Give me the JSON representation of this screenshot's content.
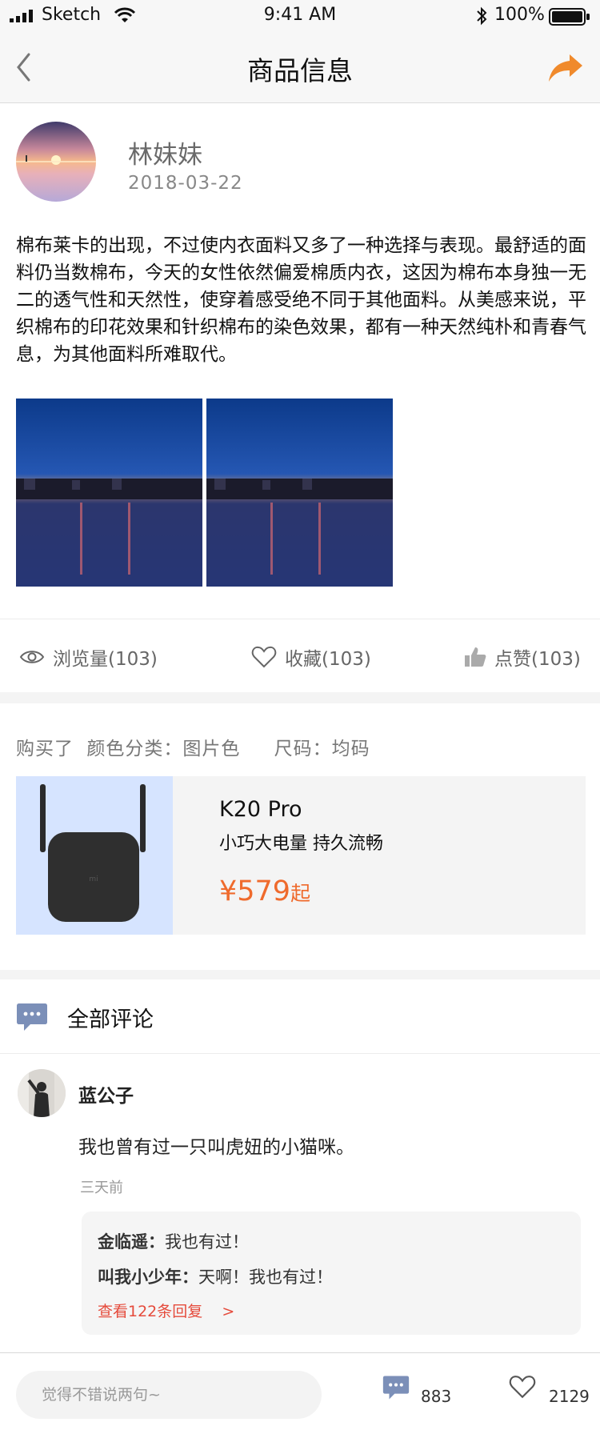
{
  "status_bar": {
    "carrier": "Sketch",
    "time": "9:41 AM",
    "battery": "100%"
  },
  "nav": {
    "title": "商品信息"
  },
  "author": {
    "name": "林妹妹",
    "date": "2018-03-22"
  },
  "post": {
    "text": "棉布莱卡的出现，不过使内衣面料又多了一种选择与表现。最舒适的面料仍当数棉布，今天的女性依然偏爱棉质内衣，这因为棉布本身独一无二的透气性和天然性，使穿着感受绝不同于其他面料。从美感来说，平织棉布的印花效果和针织棉布的染色效果，都有一种天然纯朴和青春气息，为其他面料所难取代。"
  },
  "stats": {
    "views": "浏览量(103)",
    "favorites": "收藏(103)",
    "likes": "点赞(103)"
  },
  "purchase": {
    "prefix": "购买了",
    "color": "颜色分类：图片色",
    "size": "尺码：均码"
  },
  "product": {
    "name": "K20 Pro",
    "desc": "小巧大电量 持久流畅",
    "price": "¥579",
    "price_suffix": "起",
    "price_color": "#ef6a2c",
    "image_bg": "#d6e4ff"
  },
  "comments": {
    "title": "全部评论",
    "items": [
      {
        "user": "蓝公子",
        "text": "我也曾有过一只叫虎妞的小猫咪。",
        "time": "三天前",
        "replies": [
          {
            "user": "金临遥",
            "sep": "：",
            "text": "我也有过！"
          },
          {
            "user": "叫我小少年",
            "sep": "：",
            "text": "天啊！我也有过！"
          }
        ],
        "more": "查看122条回复",
        "more_arrow": ">"
      }
    ]
  },
  "bottom": {
    "placeholder": "觉得不错说两句~",
    "comment_count": "883",
    "like_count": "2129"
  },
  "colors": {
    "accent": "#f08a2c",
    "link": "#e54b3c",
    "icon_blue": "#7b8fb8"
  }
}
